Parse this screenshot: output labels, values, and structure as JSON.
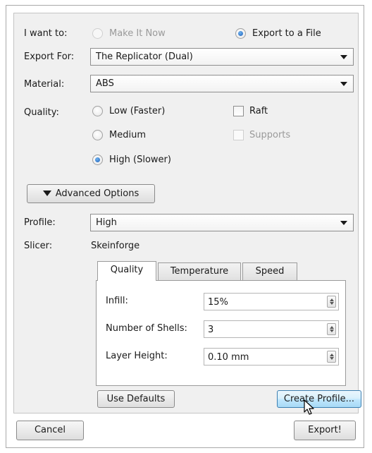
{
  "intent": {
    "label": "I want to:",
    "options": [
      {
        "label": "Make It Now",
        "checked": false,
        "enabled": false
      },
      {
        "label": "Export to a File",
        "checked": true,
        "enabled": true
      }
    ]
  },
  "export_for": {
    "label": "Export For:",
    "value": "The Replicator (Dual)"
  },
  "material": {
    "label": "Material:",
    "value": "ABS"
  },
  "quality": {
    "label": "Quality:",
    "options": [
      {
        "label": "Low (Faster)",
        "checked": false
      },
      {
        "label": "Medium",
        "checked": false
      },
      {
        "label": "High (Slower)",
        "checked": true
      }
    ],
    "raft": {
      "label": "Raft",
      "checked": false,
      "enabled": true
    },
    "supports": {
      "label": "Supports",
      "checked": false,
      "enabled": false
    }
  },
  "advanced_toggle": {
    "label": "Advanced Options"
  },
  "profile": {
    "label": "Profile:",
    "value": "High"
  },
  "slicer": {
    "label": "Slicer:",
    "value": "Skeinforge"
  },
  "tabs": [
    {
      "label": "Quality",
      "active": true
    },
    {
      "label": "Temperature",
      "active": false
    },
    {
      "label": "Speed",
      "active": false
    }
  ],
  "settings": {
    "infill": {
      "label": "Infill:",
      "value": "15%"
    },
    "shells": {
      "label": "Number of Shells:",
      "value": "3"
    },
    "layer_height": {
      "label": "Layer Height:",
      "value": "0.10 mm"
    }
  },
  "buttons": {
    "use_defaults": "Use Defaults",
    "create_profile": "Create Profile...",
    "cancel": "Cancel",
    "export": "Export!"
  },
  "icons": {
    "dropdown": "chevron-down-icon",
    "disclosure": "triangle-down-icon",
    "spinner": "spin-arrows-icon",
    "cursor": "mouse-pointer-icon"
  },
  "colors": {
    "panel_bg": "#f0f0f0",
    "hover_button": "#bee6fd",
    "radio_dot": "#1d5fb8"
  }
}
